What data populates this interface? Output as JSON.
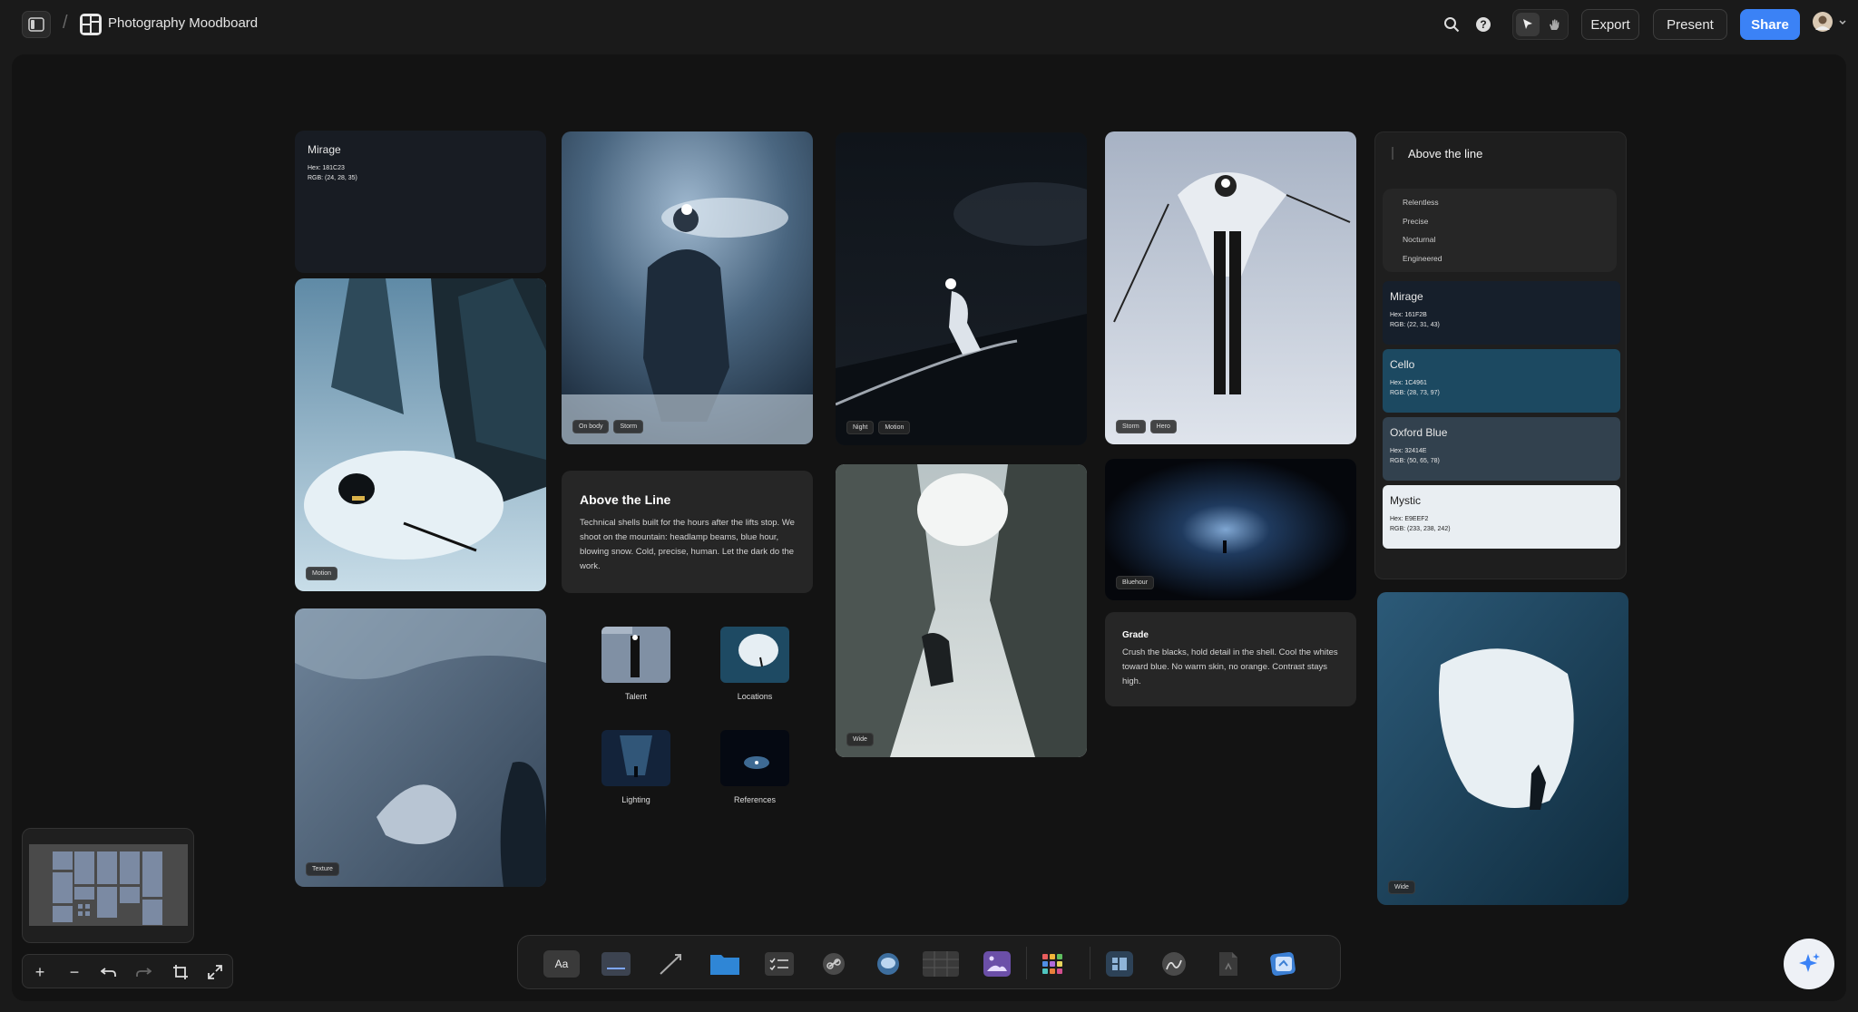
{
  "header": {
    "breadcrumb_sep": "/",
    "board_title": "Photography Moodboard",
    "export_label": "Export",
    "present_label": "Present",
    "share_label": "Share"
  },
  "mirage_card": {
    "name": "Mirage",
    "hex": "Hex: 181C23",
    "rgb": "RGB: (24, 28, 35)",
    "color": "#181c23"
  },
  "photos": {
    "headlamp_storm": {
      "tags": [
        "On body",
        "Storm"
      ]
    },
    "night_ski": {
      "tags": [
        "Night",
        "Motion"
      ]
    },
    "storm_hero": {
      "tags": [
        "Storm",
        "Hero"
      ]
    },
    "powder_motion": {
      "tags": [
        "Motion"
      ]
    },
    "bluehour": {
      "tags": [
        "Bluehour"
      ]
    },
    "couloir_wide": {
      "tags": [
        "Wide"
      ]
    },
    "ice_texture": {
      "tags": [
        "Texture"
      ]
    },
    "ice_cave_wide": {
      "tags": [
        "Wide"
      ]
    }
  },
  "note_above": {
    "title": "Above the Line",
    "body": "Technical shells built for the hours after the lifts stop. We shoot on the mountain: headlamp beams, blue hour, blowing snow. Cold, precise, human. Let the dark do the work."
  },
  "note_grade": {
    "title": "Grade",
    "body": "Crush the blacks, hold detail in the shell. Cool the whites toward blue. No warm skin, no orange. Contrast stays high."
  },
  "folders": [
    {
      "label": "Talent"
    },
    {
      "label": "Locations"
    },
    {
      "label": "Lighting"
    },
    {
      "label": "References"
    }
  ],
  "palette": {
    "title": "Above the line",
    "words": [
      "Relentless",
      "Precise",
      "Nocturnal",
      "Engineered"
    ],
    "swatches": [
      {
        "name": "Mirage",
        "hex": "Hex: 161F2B",
        "rgb": "RGB: (22, 31, 43)",
        "color": "#161f2b",
        "text": "#e8e8e8"
      },
      {
        "name": "Cello",
        "hex": "Hex: 1C4961",
        "rgb": "RGB: (28, 73, 97)",
        "color": "#1c4961",
        "text": "#e8e8e8"
      },
      {
        "name": "Oxford Blue",
        "hex": "Hex: 32414E",
        "rgb": "RGB: (50, 65, 78)",
        "color": "#32414e",
        "text": "#e8e8e8"
      },
      {
        "name": "Mystic",
        "hex": "Hex: E9EEF2",
        "rgb": "RGB: (233, 238, 242)",
        "color": "#e9eef2",
        "text": "#222222"
      }
    ]
  },
  "toolbar": {
    "text_tool_label": "Aa",
    "icons": [
      "text-tool-icon",
      "note-tool-icon",
      "line-tool-icon",
      "folder-tool-icon",
      "checklist-tool-icon",
      "link-tool-icon",
      "comment-tool-icon",
      "table-tool-icon",
      "image-tool-icon",
      "apps-tool-icon",
      "board-tool-icon",
      "sketch-tool-icon",
      "file-tool-icon",
      "upload-tool-icon"
    ]
  },
  "colors": {
    "accent": "#3b82f6",
    "canvas": "#131313"
  }
}
